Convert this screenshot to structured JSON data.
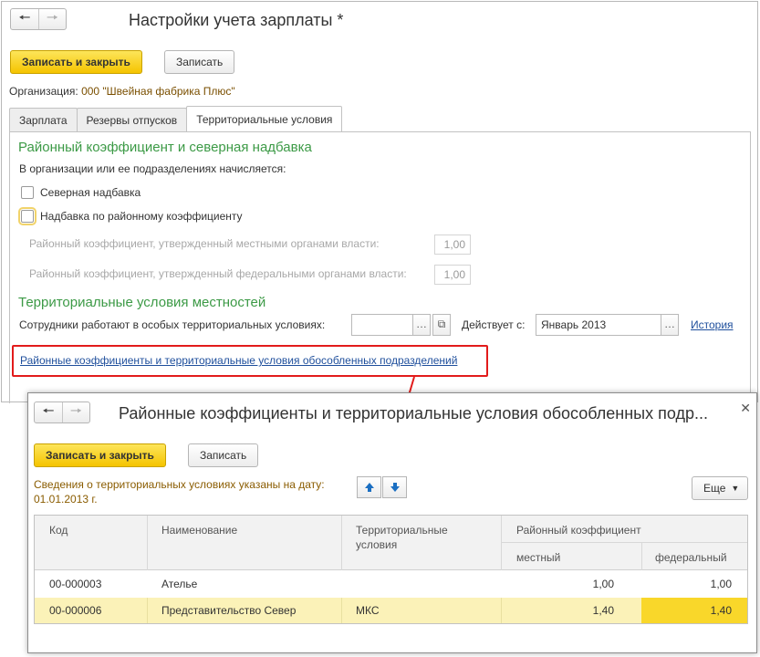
{
  "main_window": {
    "title": "Настройки учета зарплаты *",
    "save_close_label": "Записать и закрыть",
    "save_label": "Записать",
    "org_label": "Организация:",
    "org_value": "000 \"Швейная фабрика Плюс\"",
    "tabs": [
      {
        "label": "Зарплата",
        "active": false
      },
      {
        "label": "Резервы отпусков",
        "active": false
      },
      {
        "label": "Территориальные условия",
        "active": true
      }
    ],
    "section1_title": "Районный коэффициент и северная надбавка",
    "accrual_note": "В организации или ее подразделениях начисляется:",
    "northern_allowance_label": "Северная надбавка",
    "regional_allowance_label": "Надбавка по районному коэффициенту",
    "local_coef_label": "Районный коэффициент, утвержденный местными органами власти:",
    "local_coef_value": "1,00",
    "federal_coef_label": "Районный коэффициент, утвержденный федеральными органами власти:",
    "federal_coef_value": "1,00",
    "section2_title": "Территориальные условия местностей",
    "special_conditions_label": "Сотрудники работают в особых территориальных условиях:",
    "special_conditions_value": "",
    "effective_label": "Действует с:",
    "effective_value": "Январь 2013",
    "history_link": "История",
    "subdivisions_link": "Районные коэффициенты и территориальные условия обособленных подразделений"
  },
  "sub_window": {
    "title": "Районные коэффициенты и территориальные условия обособленных подр...",
    "save_close_label": "Записать и закрыть",
    "save_label": "Записать",
    "info_line1": "Сведения о территориальных условиях указаны на дату:",
    "info_line2": "01.01.2013 г.",
    "more_label": "Еще",
    "table": {
      "headers": {
        "code": "Код",
        "name": "Наименование",
        "conditions_line1": "Территориальные",
        "conditions_line2": "условия",
        "coef_group": "Районный коэффициент",
        "local": "местный",
        "federal": "федеральный"
      },
      "rows": [
        {
          "code": "00-000003",
          "name": "Ателье",
          "conditions": "",
          "local": "1,00",
          "federal": "1,00",
          "selected": false
        },
        {
          "code": "00-000006",
          "name": "Представительство Север",
          "conditions": "МКС",
          "local": "1,40",
          "federal": "1,40",
          "selected": true
        }
      ]
    }
  },
  "colors": {
    "accent_yellow": "#f5c400",
    "section_green": "#3c9a46",
    "link_blue": "#1f4f9c",
    "highlight_red": "#e21b1b"
  }
}
